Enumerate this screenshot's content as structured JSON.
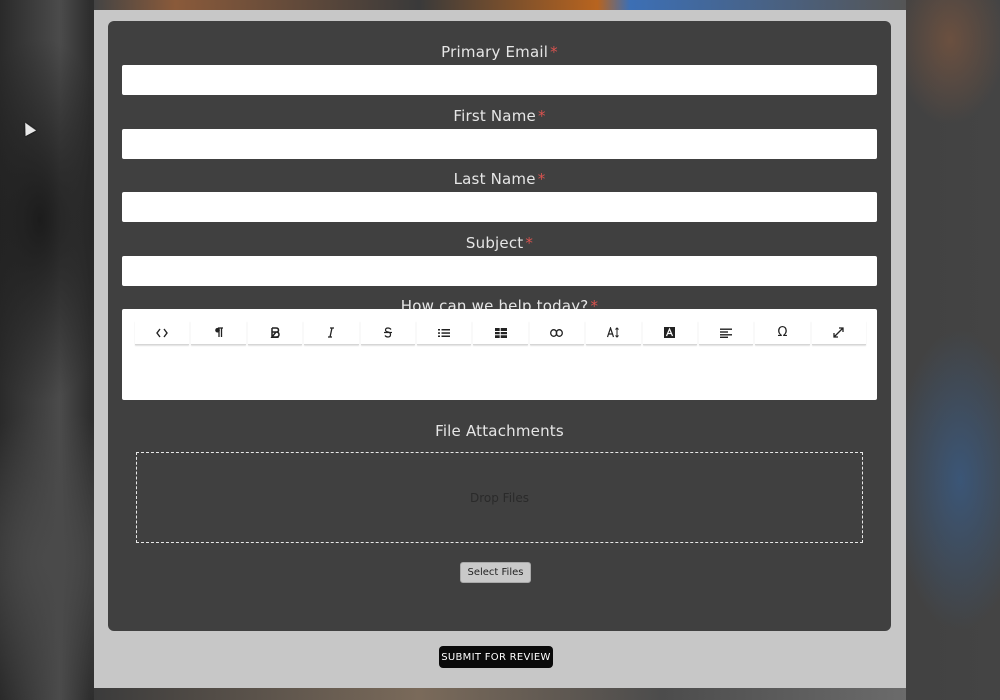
{
  "form": {
    "fields": [
      {
        "label": "Primary Email",
        "required_mark": "*",
        "value": ""
      },
      {
        "label": "First Name",
        "required_mark": "*",
        "value": ""
      },
      {
        "label": "Last Name",
        "required_mark": "*",
        "value": ""
      },
      {
        "label": "Subject",
        "required_mark": "*",
        "value": ""
      }
    ],
    "message": {
      "label": "How can we help today?",
      "required_mark": "*",
      "toolbar": [
        {
          "icon": "code-view-icon",
          "glyph": "<>"
        },
        {
          "icon": "paragraph-icon",
          "glyph": "¶"
        },
        {
          "icon": "bold-icon",
          "glyph": "B"
        },
        {
          "icon": "italic-icon",
          "glyph": "I"
        },
        {
          "icon": "strikethrough-icon",
          "glyph": "S"
        },
        {
          "icon": "list-icon",
          "glyph": "list"
        },
        {
          "icon": "table-icon",
          "glyph": "table"
        },
        {
          "icon": "link-icon",
          "glyph": "link"
        },
        {
          "icon": "font-size-icon",
          "glyph": "A↕"
        },
        {
          "icon": "font-color-icon",
          "glyph": "A"
        },
        {
          "icon": "align-left-icon",
          "glyph": "align"
        },
        {
          "icon": "special-character-icon",
          "glyph": "Ω"
        },
        {
          "icon": "fullscreen-icon",
          "glyph": "⤢"
        }
      ]
    },
    "attachments": {
      "title": "File Attachments",
      "drop_text": "Drop Files",
      "select_label": "Select Files"
    },
    "submit_label": "SUBMIT FOR REVIEW"
  },
  "colors": {
    "panel": "#404040",
    "outer": "#c7c7c7",
    "required": "#d9534f",
    "submit_bg": "#0a0a0a"
  }
}
